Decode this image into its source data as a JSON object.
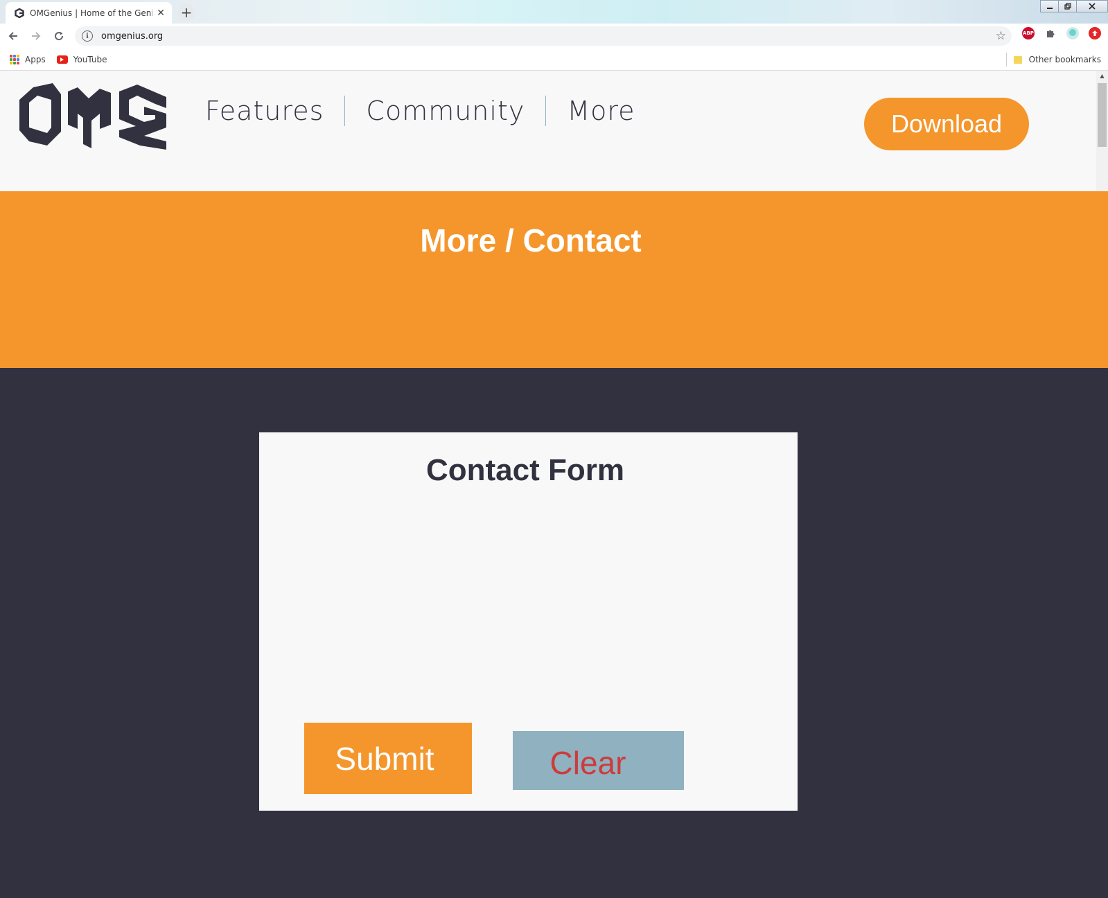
{
  "browser": {
    "tab_title": "OMGenius | Home of the Genius",
    "tab_close": "✕",
    "new_tab": "+",
    "url": "omgenius.org",
    "star": "☆",
    "extensions": {
      "abp_label": "ABP"
    },
    "bookmarks": [
      {
        "label": "Apps",
        "icon": "apps-grid-icon"
      },
      {
        "label": "YouTube",
        "icon": "youtube-icon"
      }
    ],
    "other_bookmarks": "Other bookmarks"
  },
  "site": {
    "nav": {
      "items": [
        {
          "label": "Features"
        },
        {
          "label": "Community"
        },
        {
          "label": "More"
        }
      ],
      "download_label": "Download"
    },
    "banner_title": "More / Contact",
    "form": {
      "title": "Contact Form",
      "submit_label": "Submit",
      "clear_label": "Clear"
    }
  },
  "colors": {
    "accent": "#f4962c",
    "dark": "#32313f",
    "light": "#f8f8f8",
    "clear_bg": "#8fb1c0",
    "clear_text": "#cf3a3a"
  }
}
